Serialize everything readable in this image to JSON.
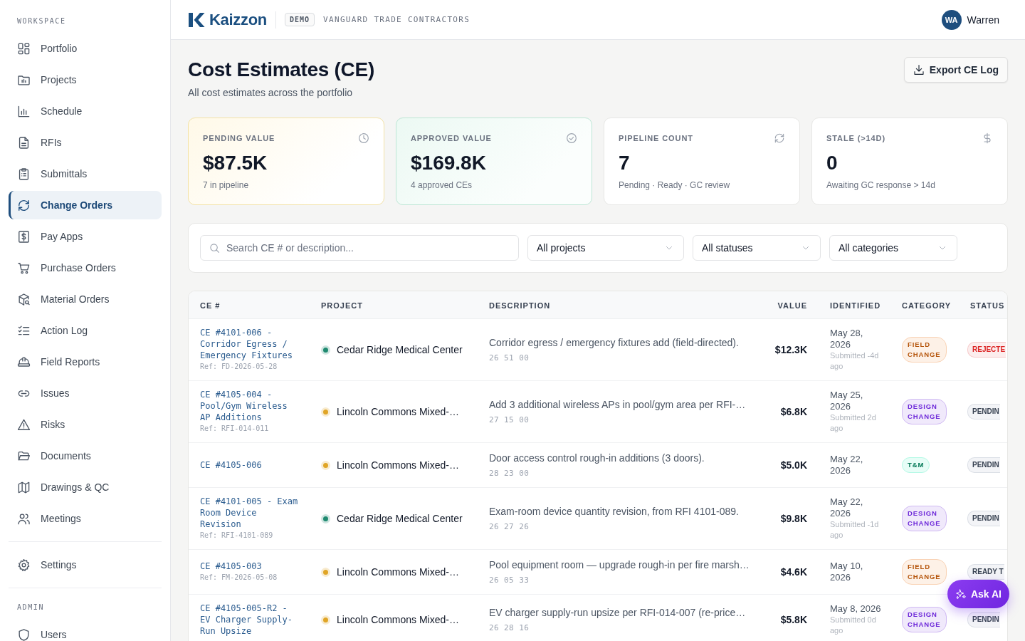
{
  "sidebar": {
    "sections": [
      {
        "label": "WORKSPACE",
        "items": [
          {
            "label": "Portfolio",
            "selected": false
          },
          {
            "label": "Projects",
            "selected": false
          },
          {
            "label": "Schedule",
            "selected": false
          },
          {
            "label": "RFIs",
            "selected": false
          },
          {
            "label": "Submittals",
            "selected": false
          },
          {
            "label": "Change Orders",
            "selected": true
          },
          {
            "label": "Pay Apps",
            "selected": false
          },
          {
            "label": "Purchase Orders",
            "selected": false
          },
          {
            "label": "Material Orders",
            "selected": false
          },
          {
            "label": "Action Log",
            "selected": false
          },
          {
            "label": "Field Reports",
            "selected": false
          },
          {
            "label": "Issues",
            "selected": false
          },
          {
            "label": "Risks",
            "selected": false
          },
          {
            "label": "Documents",
            "selected": false
          },
          {
            "label": "Drawings & QC",
            "selected": false
          },
          {
            "label": "Meetings",
            "selected": false
          }
        ]
      },
      {
        "items": [
          {
            "label": "Settings",
            "selected": false
          }
        ]
      },
      {
        "label": "ADMIN",
        "items": [
          {
            "label": "Users",
            "selected": false
          }
        ]
      }
    ]
  },
  "header": {
    "brand": "Kaizzon",
    "badge": "DEMO",
    "organization": "VANGUARD TRADE CONTRACTORS",
    "user": {
      "initials": "WA",
      "name": "Warren"
    }
  },
  "page": {
    "title": "Cost Estimates (CE)",
    "subtitle": "All cost estimates across the portfolio",
    "export_button": "Export CE Log"
  },
  "kpis": [
    {
      "label": "PENDING VALUE",
      "value": "$87.5K",
      "note": "7 in pipeline",
      "kind": "pending"
    },
    {
      "label": "APPROVED VALUE",
      "value": "$169.8K",
      "note": "4 approved CEs",
      "kind": "approved"
    },
    {
      "label": "PIPELINE COUNT",
      "value": "7",
      "note": "Pending · Ready · GC review",
      "kind": "neutral"
    },
    {
      "label": "STALE (>14D)",
      "value": "0",
      "note": "Awaiting GC response > 14d",
      "kind": "neutral"
    }
  ],
  "filters": {
    "search": {
      "placeholder": "Search CE # or description..."
    },
    "selects": [
      {
        "value": "All projects"
      },
      {
        "value": "All statuses"
      },
      {
        "value": "All categories"
      }
    ]
  },
  "table": {
    "columns": [
      "CE #",
      "PROJECT",
      "DESCRIPTION",
      "VALUE",
      "IDENTIFIED",
      "CATEGORY",
      "STATUS"
    ],
    "rows": [
      {
        "ce": "CE #4101-006 - Corridor Egress / Emergency Fixtures",
        "ref": "Ref: FD-2026-05-28",
        "project": {
          "name": "Cedar Ridge Medical Center",
          "color": "#1f8a70"
        },
        "description": "Corridor egress / emergency fixtures add (field-directed).",
        "code": "26 51 00",
        "value": "$12.3K",
        "identified": "May 28, 2026",
        "submitted": "Submitted -4d ago",
        "category": {
          "label": "FIELD CHANGE",
          "color": "#b45309"
        },
        "status": {
          "label": "REJECTE",
          "color": "#dc2626"
        }
      },
      {
        "ce": "CE #4105-004 - Pool/Gym Wireless AP Additions",
        "ref": "Ref: RFI-014-011",
        "project": {
          "name": "Lincoln Commons Mixed-…",
          "color": "#e0a526"
        },
        "description": "Add 3 additional wireless APs in pool/gym area per RFI-…",
        "code": "27 15 00",
        "value": "$6.8K",
        "identified": "May 25, 2026",
        "submitted": "Submitted 2d ago",
        "category": {
          "label": "DESIGN CHANGE",
          "color": "#6d28d9"
        },
        "status": {
          "label": "PENDIN",
          "color": "#374151"
        }
      },
      {
        "ce": "CE #4105-006",
        "project": {
          "name": "Lincoln Commons Mixed-…",
          "color": "#e0a526"
        },
        "description": "Door access control rough-in additions (3 doors).",
        "code": "28 23 00",
        "value": "$5.0K",
        "identified": "May 22, 2026",
        "category": {
          "label": "T&M",
          "color": "#047857"
        },
        "status": {
          "label": "PENDIN",
          "color": "#374151"
        }
      },
      {
        "ce": "CE #4101-005 - Exam Room Device Revision",
        "ref": "Ref: RFI-4101-089",
        "project": {
          "name": "Cedar Ridge Medical Center",
          "color": "#1f8a70"
        },
        "description": "Exam-room device quantity revision, from RFI 4101-089.",
        "code": "26 27 26",
        "value": "$9.8K",
        "identified": "May 22, 2026",
        "submitted": "Submitted -1d ago",
        "category": {
          "label": "DESIGN CHANGE",
          "color": "#6d28d9"
        },
        "status": {
          "label": "PENDIN",
          "color": "#374151"
        }
      },
      {
        "ce": "CE #4105-003",
        "ref": "Ref: FM-2026-05-08",
        "project": {
          "name": "Lincoln Commons Mixed-…",
          "color": "#e0a526"
        },
        "description": "Pool equipment room — upgrade rough-in per fire marsh…",
        "code": "26 05 33",
        "value": "$4.6K",
        "identified": "May 10, 2026",
        "category": {
          "label": "FIELD CHANGE",
          "color": "#b45309"
        },
        "status": {
          "label": "READY T",
          "color": "#374151"
        }
      },
      {
        "ce": "CE #4105-005-R2 - EV Charger Supply-Run Upsize",
        "project": {
          "name": "Lincoln Commons Mixed-…",
          "color": "#e0a526"
        },
        "description": "EV charger supply-run upsize per RFI-014-007 (re-price…",
        "code": "26 28 16",
        "value": "$5.8K",
        "identified": "May 8, 2026",
        "submitted": "Submitted 0d ago",
        "category": {
          "label": "DESIGN CHANGE",
          "color": "#6d28d9"
        },
        "status": {
          "label": "PENDIN",
          "color": "#374151"
        }
      }
    ]
  },
  "assistant_button": "Ask AI"
}
